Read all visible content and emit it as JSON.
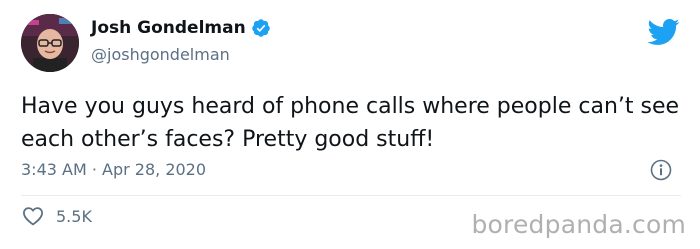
{
  "author": {
    "display_name": "Josh Gondelman",
    "handle": "@joshgondelman",
    "verified": true
  },
  "tweet": {
    "text": "Have you guys heard of phone calls where people can’t see each other’s faces? Pretty good stuff!",
    "timestamp": "3:43 AM · Apr 28, 2020",
    "likes": "5.5K"
  },
  "icons": {
    "brand": "twitter-bird-icon",
    "verified": "verified-badge-icon",
    "info": "info-icon",
    "like": "heart-icon"
  },
  "watermark": "boredpanda.com",
  "colors": {
    "twitter_blue": "#1da1f2",
    "secondary_text": "#5b7083",
    "primary_text": "#0f1419",
    "divider": "#e6ecf0",
    "watermark": "#b0b0b0"
  }
}
